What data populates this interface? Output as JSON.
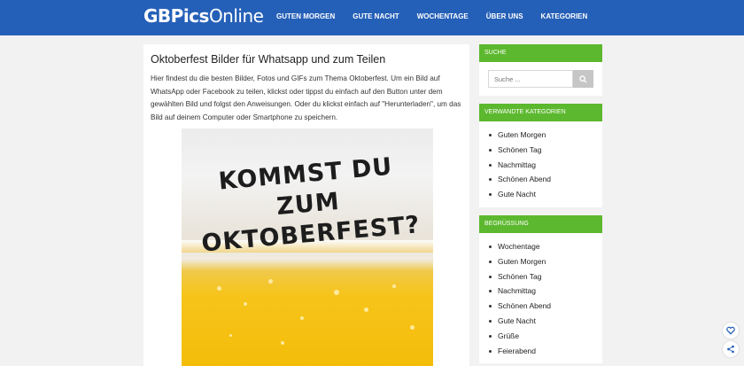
{
  "header": {
    "logo": {
      "part1": "GBPics",
      "part2": "Online"
    },
    "nav": [
      {
        "label": "GUTEN MORGEN"
      },
      {
        "label": "GUTE NACHT"
      },
      {
        "label": "WOCHENTAGE"
      },
      {
        "label": "ÜBER UNS"
      },
      {
        "label": "KATEGORIEN"
      }
    ]
  },
  "article": {
    "title": "Oktoberfest Bilder für Whatsapp und zum Teilen",
    "intro": "Hier findest du die besten Bilder, Fotos und GIFs zum Thema Oktoberfest. Um ein Bild auf WhatsApp oder Facebook zu teilen, klickst oder tippst du einfach auf den Button unter dem gewählten Bild und folgst den Anweisungen. Oder du klickst einfach auf \"Herunterladen\", um das Bild auf deinem Computer oder Smartphone zu speichern.",
    "image_caption": "KOMMST DU ZUM OKTOBERFEST?"
  },
  "sidebar": {
    "search": {
      "title": "SUCHE",
      "placeholder": "Suche ...",
      "icon": "search-icon"
    },
    "related": {
      "title": "VERWANDTE KATEGORIEN",
      "items": [
        "Guten Morgen",
        "Schönen Tag",
        "Nachmittag",
        "Schönen Abend",
        "Gute Nacht"
      ]
    },
    "greeting": {
      "title": "BEGRÜSSUNG",
      "items": [
        "Wochentage",
        "Guten Morgen",
        "Schönen Tag",
        "Nachmittag",
        "Schönen Abend",
        "Gute Nacht",
        "Grüße",
        "Feierabend"
      ]
    }
  },
  "floating": {
    "favorite_icon": "heart-icon",
    "share_icon": "share-icon"
  },
  "colors": {
    "header": "#2560b8",
    "widget_title": "#5cb82e"
  }
}
